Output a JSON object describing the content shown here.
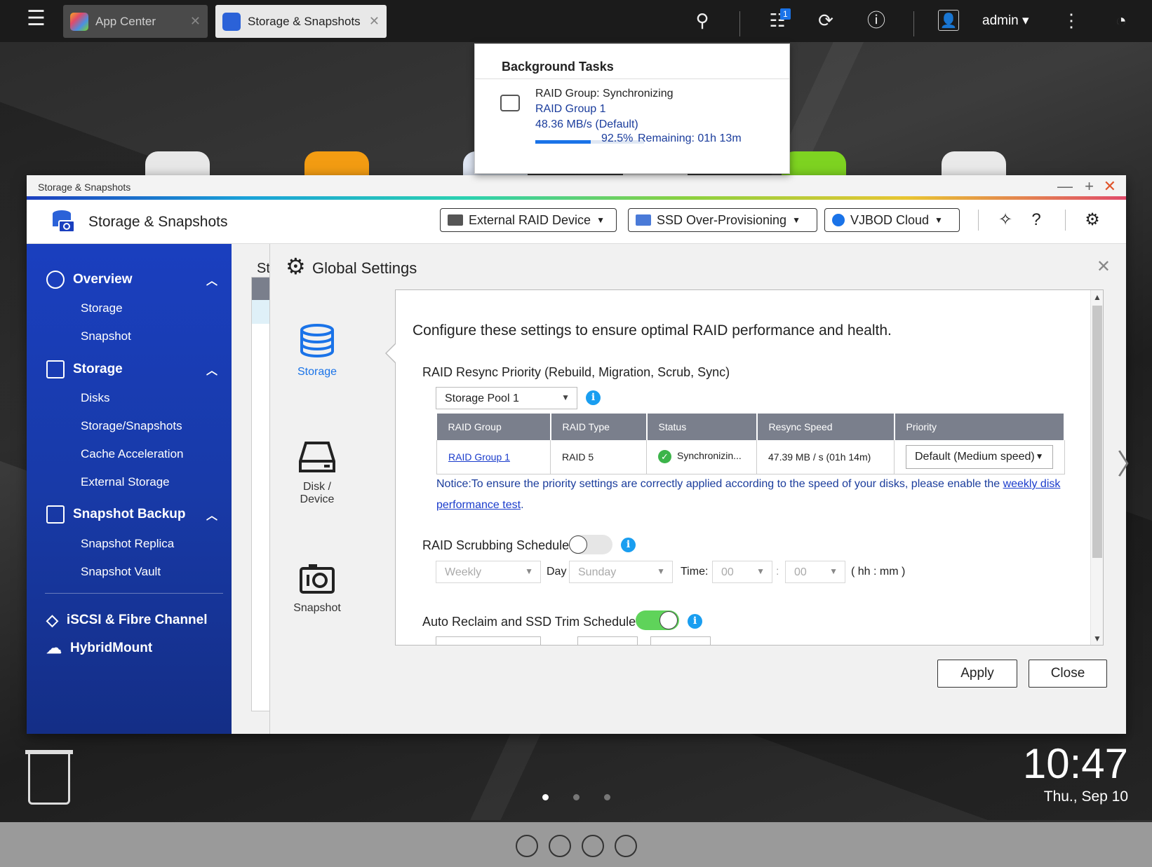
{
  "taskbar": {
    "tabs": [
      {
        "label": "App Center"
      },
      {
        "label": "Storage & Snapshots"
      }
    ],
    "notification_count": "1",
    "user": "admin"
  },
  "background_tasks": {
    "title": "Background Tasks",
    "line1": "RAID Group: Synchronizing",
    "line2": "RAID Group 1",
    "line3": "48.36 MB/s (Default)",
    "progress_text": "92.5%",
    "remaining": "Remaining: 01h 13m",
    "progress": 0.925
  },
  "window": {
    "titlebar": "Storage & Snapshots",
    "app_title": "Storage & Snapshots",
    "header_buttons": [
      "External RAID Device",
      "SSD Over-Provisioning",
      "VJBOD Cloud"
    ]
  },
  "sidebar": {
    "overview": {
      "label": "Overview",
      "items": [
        "Storage",
        "Snapshot"
      ]
    },
    "storage": {
      "label": "Storage",
      "items": [
        "Disks",
        "Storage/Snapshots",
        "Cache Acceleration",
        "External Storage"
      ]
    },
    "snapshot_backup": {
      "label": "Snapshot Backup",
      "items": [
        "Snapshot Replica",
        "Snapshot Vault"
      ]
    },
    "iscsi": "iSCSI & Fibre Channel",
    "hybridmount": "HybridMount"
  },
  "main_partial_title": "St",
  "dialog": {
    "title": "Global Settings",
    "nav": [
      {
        "label": "Storage",
        "icon": "database-icon",
        "active": true
      },
      {
        "label": "Disk /\nDevice",
        "icon": "disk-icon",
        "active": false
      },
      {
        "label": "Snapshot",
        "icon": "camera-icon",
        "active": false
      }
    ],
    "intro": "Configure these settings to ensure optimal RAID performance and health.",
    "resync": {
      "heading": "RAID Resync Priority (Rebuild, Migration, Scrub, Sync)",
      "pool": "Storage Pool 1",
      "columns": [
        "RAID Group",
        "RAID Type",
        "Status",
        "Resync Speed",
        "Priority"
      ],
      "row": {
        "group": "RAID Group 1",
        "type": "RAID 5",
        "status": "Synchronizin...",
        "speed": "47.39 MB / s (01h 14m)",
        "priority": "Default (Medium speed)"
      },
      "notice_prefix": "Notice:To ensure the priority settings are correctly applied according to the speed of your disks, please enable the ",
      "notice_link": "weekly disk performance test",
      "notice_suffix": "."
    },
    "scrubbing": {
      "heading": "RAID Scrubbing Schedule",
      "enabled": false,
      "frequency": "Weekly",
      "day_label": "Day",
      "day": "Sunday",
      "time_label": "Time:",
      "hour": "00",
      "sep": ":",
      "minute": "00",
      "format": "( hh : mm )"
    },
    "reclaim": {
      "heading": "Auto Reclaim and SSD Trim Schedule",
      "enabled": true
    },
    "apply": "Apply",
    "close": "Close"
  },
  "clock": {
    "time": "10:47",
    "date": "Thu., Sep 10"
  },
  "colors": {
    "accent": "#1a73e8",
    "sidebar": "#1a3fbf",
    "toggle_on": "#5fd35a"
  }
}
